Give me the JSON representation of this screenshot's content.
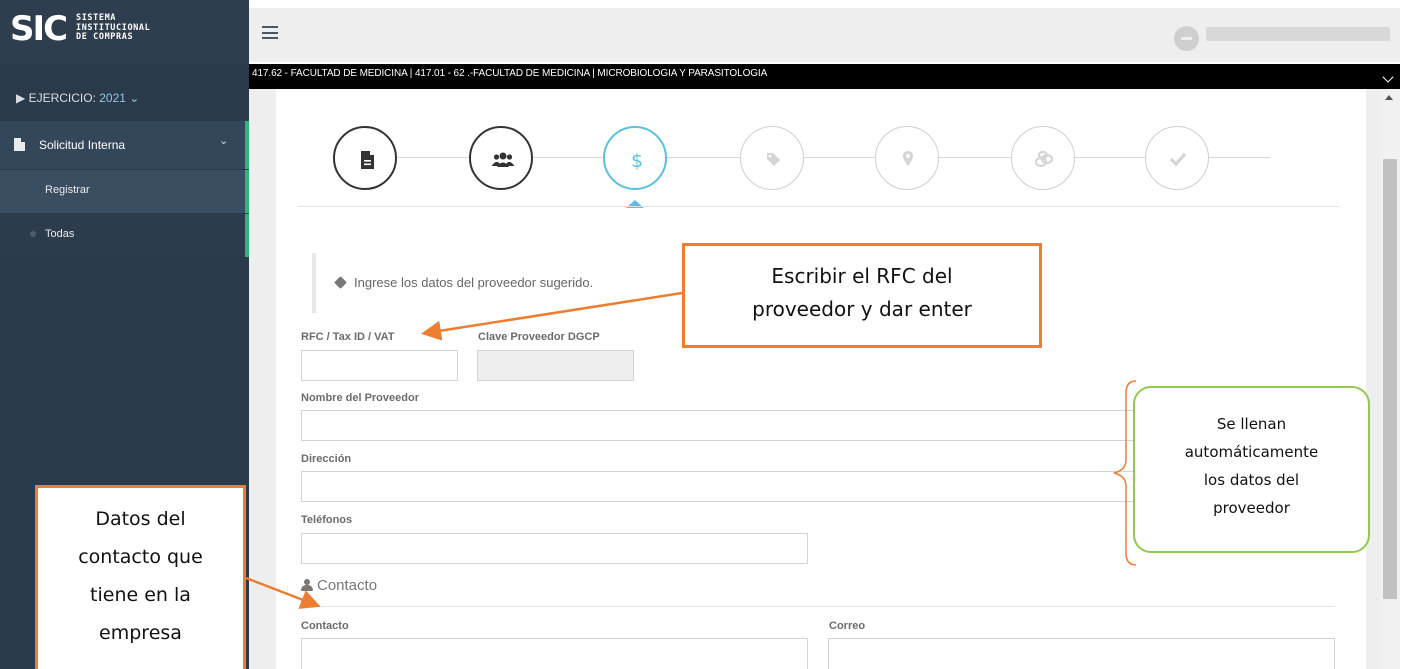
{
  "sidebar": {
    "logo_mark": "SIC",
    "logo_line1": "SISTEMA",
    "logo_line2": "INSTITUCIONAL",
    "logo_line3": "DE COMPRAS",
    "ejercicio_label": "▶ EJERCICIO:",
    "ejercicio_value": "2021 ⌄",
    "menu_parent": "Solicitud Interna",
    "menu_parent_chevron": "⌄",
    "items": [
      {
        "label": "Registrar"
      },
      {
        "label": "Todas"
      }
    ]
  },
  "header": {
    "context_path": "417.62 - FACULTAD DE MEDICINA | 417.01 - 62 .-FACULTAD DE MEDICINA | MICROBIOLOGIA Y PARASITOLOGIA"
  },
  "stepper": {
    "steps": [
      {
        "icon": "document-icon",
        "state": "done"
      },
      {
        "icon": "users-icon",
        "state": "done"
      },
      {
        "icon": "dollar-icon",
        "state": "active",
        "symbol": "$"
      },
      {
        "icon": "tag-icon",
        "state": "pending"
      },
      {
        "icon": "map-marker-icon",
        "state": "pending"
      },
      {
        "icon": "coins-icon",
        "state": "pending"
      },
      {
        "icon": "check-icon",
        "state": "pending"
      }
    ]
  },
  "form": {
    "info_text": "Ingrese los datos del proveedor sugerido.",
    "rfc_label": "RFC / Tax ID / VAT",
    "rfc_value": "",
    "clave_label": "Clave Proveedor DGCP",
    "clave_value": "",
    "nombre_label": "Nombre del Proveedor",
    "nombre_value": "",
    "direccion_label": "Dirección",
    "direccion_value": "",
    "telefonos_label": "Teléfonos",
    "telefonos_value": "",
    "contact_section_title": "Contacto",
    "contacto_label": "Contacto",
    "contacto_value": "",
    "correo_label": "Correo",
    "correo_value": ""
  },
  "annotations": {
    "rfc_callout": [
      "Escribir el RFC del",
      "proveedor y dar enter"
    ],
    "contact_callout": [
      "Datos del",
      "contacto que",
      "tiene en la",
      "empresa"
    ],
    "auto_callout": [
      "Se llenan",
      "automáticamente",
      "los datos del",
      "proveedor"
    ],
    "colors": {
      "orange": "#ed7d31",
      "green": "#92c850",
      "accent": "#5bc0de",
      "sidebar": "#2b3a4a",
      "active_bar": "#2eb873"
    }
  }
}
